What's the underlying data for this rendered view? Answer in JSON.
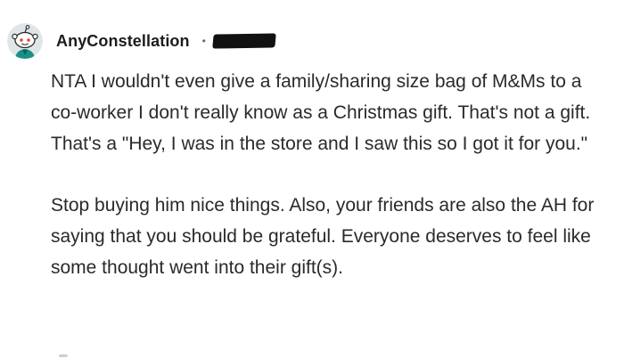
{
  "comment": {
    "author": "AnyConstellation",
    "separator": "•",
    "avatar_icon": "reddit-snoo-avatar-icon",
    "paragraphs": [
      "NTA I wouldn't even give a family/sharing size bag of M&Ms to a co-worker I don't really know as a Christmas gift. That's not a gift. That's a \"Hey, I was in the store and I saw this so I got it for you.\"",
      "Stop buying him nice things. Also, your friends are also the AH for saying that you should be grateful. Everyone deserves to feel like some thought went into their gift(s)."
    ]
  },
  "colors": {
    "text": "#2a2a2a",
    "author": "#1c1c1c",
    "meta": "#576f76",
    "redaction": "#111111",
    "avatar_background": "#dfe6e8",
    "avatar_shirt": "#1a8f86"
  }
}
